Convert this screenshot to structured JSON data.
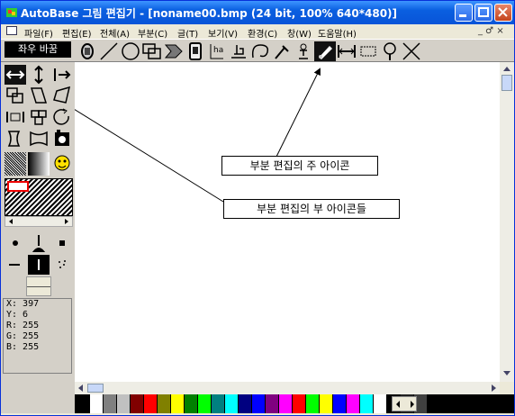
{
  "window": {
    "title": "AutoBase 그림 편집기 - [noname00.bmp (24 bit, 100% 640*480)]",
    "title_color": "#0A5FE0"
  },
  "menu": [
    "파일(F)",
    "편집(E)",
    "전체(A)",
    "부분(C)",
    "글(T)",
    "보기(V)",
    "환경(C)",
    "창(W)",
    "도움말(H)"
  ],
  "mdi_controls": "_ ♂ ×",
  "toolbar": {
    "mode_label": "좌우 바꿈",
    "icons": [
      "stamp-icon",
      "line-icon",
      "circle-icon",
      "rect-overlap-icon",
      "fill-arrow-icon",
      "card-icon",
      "text-cursor-icon",
      "bucket-icon",
      "lasso-icon",
      "dropper-icon",
      "figure-icon",
      "brush-active-icon",
      "resize-h-icon",
      "select-rect-icon",
      "magnifier-icon",
      "close-x-icon"
    ]
  },
  "left_tools": [
    "flip-h-icon",
    "flip-v-icon",
    "move-right-icon",
    "copy-rect-icon",
    "skew-icon",
    "distort-icon",
    "stretch-icon",
    "tile-icon",
    "rotate-icon",
    "warp-left-icon",
    "warp-bottom-icon",
    "stamp-dark-icon"
  ],
  "coords": {
    "x": "X: 397",
    "y": "Y: 6",
    "r": "R: 255",
    "g": "G: 255",
    "b": "B: 255"
  },
  "callouts": {
    "main": "부분 편집의 주 아이콘",
    "sub": "부분 편집의 부 아이콘들"
  },
  "palette": [
    "#000000",
    "#FFFFFF",
    "#808080",
    "#C0C0C0",
    "#800000",
    "#FF0000",
    "#808000",
    "#FFFF00",
    "#008000",
    "#00FF00",
    "#008080",
    "#00FFFF",
    "#000080",
    "#0000FF",
    "#800080",
    "#FF00FF",
    "#FF0000",
    "#00FF00",
    "#FFFF00",
    "#0000FF",
    "#FF00FF",
    "#00FFFF",
    "#FFFFFF",
    "#000000",
    "#202020",
    "#404040"
  ]
}
